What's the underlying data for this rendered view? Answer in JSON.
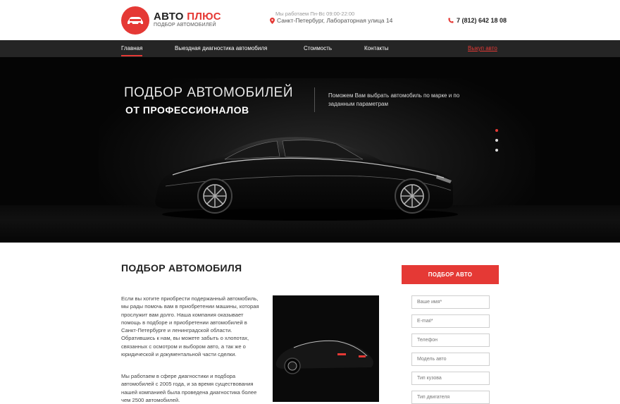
{
  "header": {
    "brand_main": "АВТО",
    "brand_accent": "ПЛЮС",
    "brand_sub": "ПОДБОР АВТОМОБИЛЕЙ",
    "hours": "Мы работаем Пн-Вс 09:00-22:00",
    "address": "Санкт-Петербург, Лабораторная улица 14",
    "phone": "7 (812) 642 18 08"
  },
  "nav": {
    "items": [
      {
        "label": "Главная"
      },
      {
        "label": "Выездная диагностика автомобиля"
      },
      {
        "label": "Стоимость"
      },
      {
        "label": "Контакты"
      }
    ],
    "buy_label": "Выкуп авто"
  },
  "hero": {
    "title_line1": "ПОДБОР АВТОМОБИЛЕЙ",
    "title_line2": "ОТ ПРОФЕССИОНАЛОВ",
    "text": "Поможем Вам выбрать автомобиль по марке и по заданным параметрам"
  },
  "content": {
    "title": "ПОДБОР АВТОМОБИЛЯ",
    "para1": "Если вы хотите приобрести подержанный автомобиль, мы рады помочь вам в приобретении машины, которая прослужит вам долго. Наша компания оказывает помощь в подборе и приобретении автомобилей в Санкт-Петербурге и ленинградской области. Обратившись к нам, вы можете забыть о хлопотах, связанных с осмотром и выбором авто, а так же о юридической и документальной части сделки.",
    "para2": "Мы работаем в сфере диагностики и подбора автомобилей с 2005 года, и за время существования нашей компанией была проведена диагностика более чем 2500 автомобилей."
  },
  "form": {
    "cta_label": "ПОДБОР АВТО",
    "placeholders": {
      "name": "Ваше имя*",
      "email": "E-mail*",
      "phone": "Телефон",
      "model": "Модель авто",
      "body": "Тип кузова",
      "engine": "Тип двигателя"
    }
  },
  "colors": {
    "accent": "#e53935",
    "nav_bg": "#252525"
  }
}
